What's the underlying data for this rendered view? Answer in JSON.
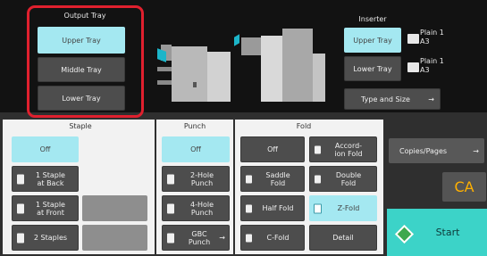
{
  "output_tray": {
    "title": "Output Tray",
    "upper": "Upper Tray",
    "middle": "Middle Tray",
    "lower": "Lower Tray"
  },
  "inserter": {
    "title": "Inserter",
    "upper": "Upper Tray",
    "lower": "Lower Tray",
    "upper_paper": [
      "Plain 1",
      "A3"
    ],
    "lower_paper": [
      "Plain 1",
      "A3"
    ],
    "type_size": "Type and Size",
    "type_size_arrow": "→"
  },
  "staple": {
    "title": "Staple",
    "off": "Off",
    "back": [
      "1 Staple",
      "at Back"
    ],
    "front": [
      "1 Staple",
      "at Front"
    ],
    "two": "2 Staples"
  },
  "punch": {
    "title": "Punch",
    "off": "Off",
    "two_hole": [
      "2-Hole",
      "Punch"
    ],
    "four_hole": [
      "4-Hole",
      "Punch"
    ],
    "gbc": [
      "GBC",
      "Punch"
    ],
    "gbc_arrow": "→"
  },
  "fold": {
    "title": "Fold",
    "off": "Off",
    "accordion": [
      "Accord-",
      "ion Fold"
    ],
    "saddle": [
      "Saddle",
      "Fold"
    ],
    "double": [
      "Double",
      "Fold"
    ],
    "half": "Half Fold",
    "z": "Z-Fold",
    "c": "C-Fold",
    "detail": "Detail"
  },
  "right": {
    "copies": "Copies/Pages",
    "copies_arrow": "→",
    "ca": "CA",
    "start": "Start"
  },
  "colors": {
    "selected": "#a4e8f1",
    "highlight_border": "#e0202e",
    "start": "#3cd3c8"
  }
}
